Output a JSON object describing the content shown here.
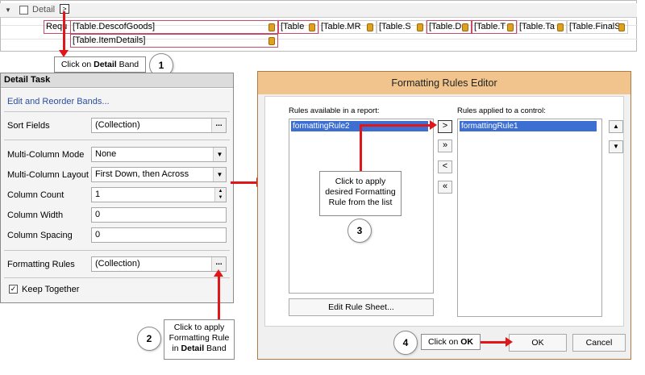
{
  "designer": {
    "band_title": "Detail",
    "smart_tag": ">",
    "cells_row1": [
      "Requ",
      "[Table.DescofGoods]",
      "[Table",
      "[Table.MR",
      "[Table.S",
      "[Table.D",
      "[Table.T",
      "[Table.Ta",
      "[Table.FinalS"
    ],
    "cells_row2": [
      "[Table.ItemDetails]"
    ]
  },
  "callouts": {
    "c1_prefix": "Click on ",
    "c1_bold": "Detail",
    "c1_suffix": " Band",
    "c1_num": "1",
    "c2_line1": "Click to apply",
    "c2_line2": "Formatting Rule",
    "c2_line3_prefix": "in ",
    "c2_line3_bold": "Detail",
    "c2_line3_suffix": " Band",
    "c2_num": "2",
    "c3_line1": "Click to apply",
    "c3_line2": "desired Formatting",
    "c3_line3": "Rule from the list",
    "c3_num": "3",
    "c4_prefix": "Click on ",
    "c4_bold": "OK",
    "c4_num": "4"
  },
  "task": {
    "title": "Detail Task",
    "edit_link": "Edit and Reorder Bands...",
    "sort_label": "Sort Fields",
    "sort_value": "(Collection)",
    "mcmode_label": "Multi-Column Mode",
    "mcmode_value": "None",
    "mclayout_label": "Multi-Column Layout",
    "mclayout_value": "First Down, then Across",
    "colcount_label": "Column Count",
    "colcount_value": "1",
    "colwidth_label": "Column Width",
    "colwidth_value": "0",
    "colspacing_label": "Column Spacing",
    "colspacing_value": "0",
    "fr_label": "Formatting Rules",
    "fr_value": "(Collection)",
    "keep_label": "Keep Together",
    "ellipsis": "..."
  },
  "editor": {
    "title": "Formatting Rules Editor",
    "available_label": "Rules available in a report:",
    "applied_label": "Rules applied to a control:",
    "available_items": [
      "formattingRule2"
    ],
    "applied_items": [
      "formattingRule1"
    ],
    "btn_add": ">",
    "btn_add_all": "»",
    "btn_remove": "<",
    "btn_remove_all": "«",
    "btn_up": "▲",
    "btn_down": "▼",
    "edit_sheet": "Edit Rule Sheet...",
    "ok": "OK",
    "cancel": "Cancel"
  }
}
